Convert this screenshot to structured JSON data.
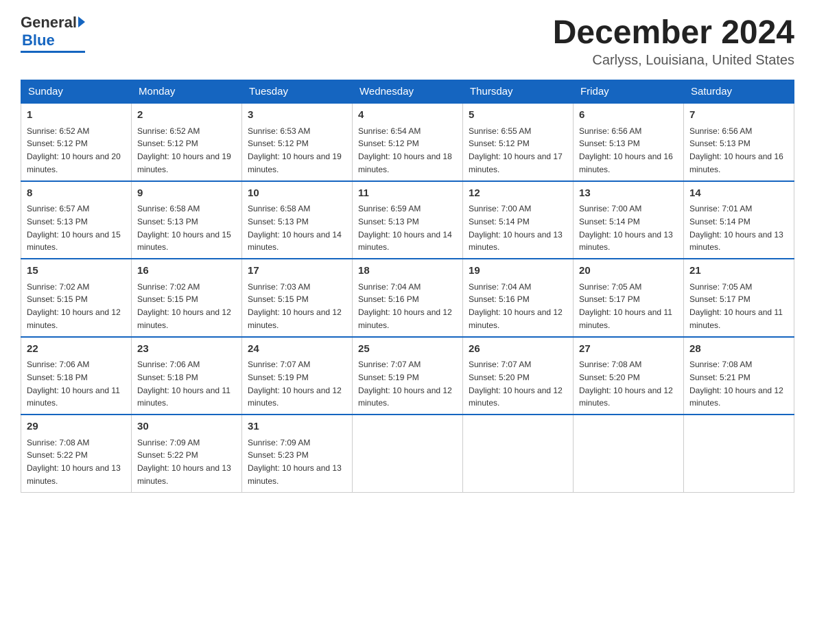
{
  "logo": {
    "general": "General",
    "blue": "Blue"
  },
  "header": {
    "month_year": "December 2024",
    "location": "Carlyss, Louisiana, United States"
  },
  "days_of_week": [
    "Sunday",
    "Monday",
    "Tuesday",
    "Wednesday",
    "Thursday",
    "Friday",
    "Saturday"
  ],
  "weeks": [
    [
      {
        "day": 1,
        "sunrise": "6:52 AM",
        "sunset": "5:12 PM",
        "daylight": "10 hours and 20 minutes."
      },
      {
        "day": 2,
        "sunrise": "6:52 AM",
        "sunset": "5:12 PM",
        "daylight": "10 hours and 19 minutes."
      },
      {
        "day": 3,
        "sunrise": "6:53 AM",
        "sunset": "5:12 PM",
        "daylight": "10 hours and 19 minutes."
      },
      {
        "day": 4,
        "sunrise": "6:54 AM",
        "sunset": "5:12 PM",
        "daylight": "10 hours and 18 minutes."
      },
      {
        "day": 5,
        "sunrise": "6:55 AM",
        "sunset": "5:12 PM",
        "daylight": "10 hours and 17 minutes."
      },
      {
        "day": 6,
        "sunrise": "6:56 AM",
        "sunset": "5:13 PM",
        "daylight": "10 hours and 16 minutes."
      },
      {
        "day": 7,
        "sunrise": "6:56 AM",
        "sunset": "5:13 PM",
        "daylight": "10 hours and 16 minutes."
      }
    ],
    [
      {
        "day": 8,
        "sunrise": "6:57 AM",
        "sunset": "5:13 PM",
        "daylight": "10 hours and 15 minutes."
      },
      {
        "day": 9,
        "sunrise": "6:58 AM",
        "sunset": "5:13 PM",
        "daylight": "10 hours and 15 minutes."
      },
      {
        "day": 10,
        "sunrise": "6:58 AM",
        "sunset": "5:13 PM",
        "daylight": "10 hours and 14 minutes."
      },
      {
        "day": 11,
        "sunrise": "6:59 AM",
        "sunset": "5:13 PM",
        "daylight": "10 hours and 14 minutes."
      },
      {
        "day": 12,
        "sunrise": "7:00 AM",
        "sunset": "5:14 PM",
        "daylight": "10 hours and 13 minutes."
      },
      {
        "day": 13,
        "sunrise": "7:00 AM",
        "sunset": "5:14 PM",
        "daylight": "10 hours and 13 minutes."
      },
      {
        "day": 14,
        "sunrise": "7:01 AM",
        "sunset": "5:14 PM",
        "daylight": "10 hours and 13 minutes."
      }
    ],
    [
      {
        "day": 15,
        "sunrise": "7:02 AM",
        "sunset": "5:15 PM",
        "daylight": "10 hours and 12 minutes."
      },
      {
        "day": 16,
        "sunrise": "7:02 AM",
        "sunset": "5:15 PM",
        "daylight": "10 hours and 12 minutes."
      },
      {
        "day": 17,
        "sunrise": "7:03 AM",
        "sunset": "5:15 PM",
        "daylight": "10 hours and 12 minutes."
      },
      {
        "day": 18,
        "sunrise": "7:04 AM",
        "sunset": "5:16 PM",
        "daylight": "10 hours and 12 minutes."
      },
      {
        "day": 19,
        "sunrise": "7:04 AM",
        "sunset": "5:16 PM",
        "daylight": "10 hours and 12 minutes."
      },
      {
        "day": 20,
        "sunrise": "7:05 AM",
        "sunset": "5:17 PM",
        "daylight": "10 hours and 11 minutes."
      },
      {
        "day": 21,
        "sunrise": "7:05 AM",
        "sunset": "5:17 PM",
        "daylight": "10 hours and 11 minutes."
      }
    ],
    [
      {
        "day": 22,
        "sunrise": "7:06 AM",
        "sunset": "5:18 PM",
        "daylight": "10 hours and 11 minutes."
      },
      {
        "day": 23,
        "sunrise": "7:06 AM",
        "sunset": "5:18 PM",
        "daylight": "10 hours and 11 minutes."
      },
      {
        "day": 24,
        "sunrise": "7:07 AM",
        "sunset": "5:19 PM",
        "daylight": "10 hours and 12 minutes."
      },
      {
        "day": 25,
        "sunrise": "7:07 AM",
        "sunset": "5:19 PM",
        "daylight": "10 hours and 12 minutes."
      },
      {
        "day": 26,
        "sunrise": "7:07 AM",
        "sunset": "5:20 PM",
        "daylight": "10 hours and 12 minutes."
      },
      {
        "day": 27,
        "sunrise": "7:08 AM",
        "sunset": "5:20 PM",
        "daylight": "10 hours and 12 minutes."
      },
      {
        "day": 28,
        "sunrise": "7:08 AM",
        "sunset": "5:21 PM",
        "daylight": "10 hours and 12 minutes."
      }
    ],
    [
      {
        "day": 29,
        "sunrise": "7:08 AM",
        "sunset": "5:22 PM",
        "daylight": "10 hours and 13 minutes."
      },
      {
        "day": 30,
        "sunrise": "7:09 AM",
        "sunset": "5:22 PM",
        "daylight": "10 hours and 13 minutes."
      },
      {
        "day": 31,
        "sunrise": "7:09 AM",
        "sunset": "5:23 PM",
        "daylight": "10 hours and 13 minutes."
      },
      null,
      null,
      null,
      null
    ]
  ]
}
